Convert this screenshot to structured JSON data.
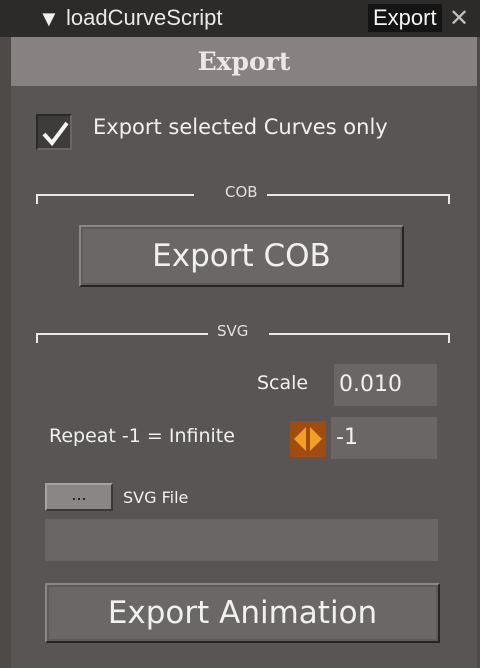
{
  "titlebar": {
    "dropdown_icon": "triangle-down-icon",
    "script_name": "loadCurveScript",
    "active_tab": "Export",
    "close_glyph": "✕"
  },
  "panel": {
    "header": "Export",
    "checkbox": {
      "label": "Export selected Curves only",
      "checked": true
    },
    "cob_group": {
      "label": "COB",
      "button_label": "Export COB"
    },
    "svg_group": {
      "label": "SVG",
      "scale_label": "Scale",
      "scale_value": "0.010",
      "repeat_label": "Repeat -1 = Infinite",
      "repeat_value": "-1",
      "file_button_label": "...",
      "file_label": "SVG File",
      "file_path": ""
    },
    "export_animation_label": "Export Animation"
  },
  "colors": {
    "accent": "#a14b0f",
    "panel_bg": "#585554",
    "header_bg": "#878281"
  }
}
